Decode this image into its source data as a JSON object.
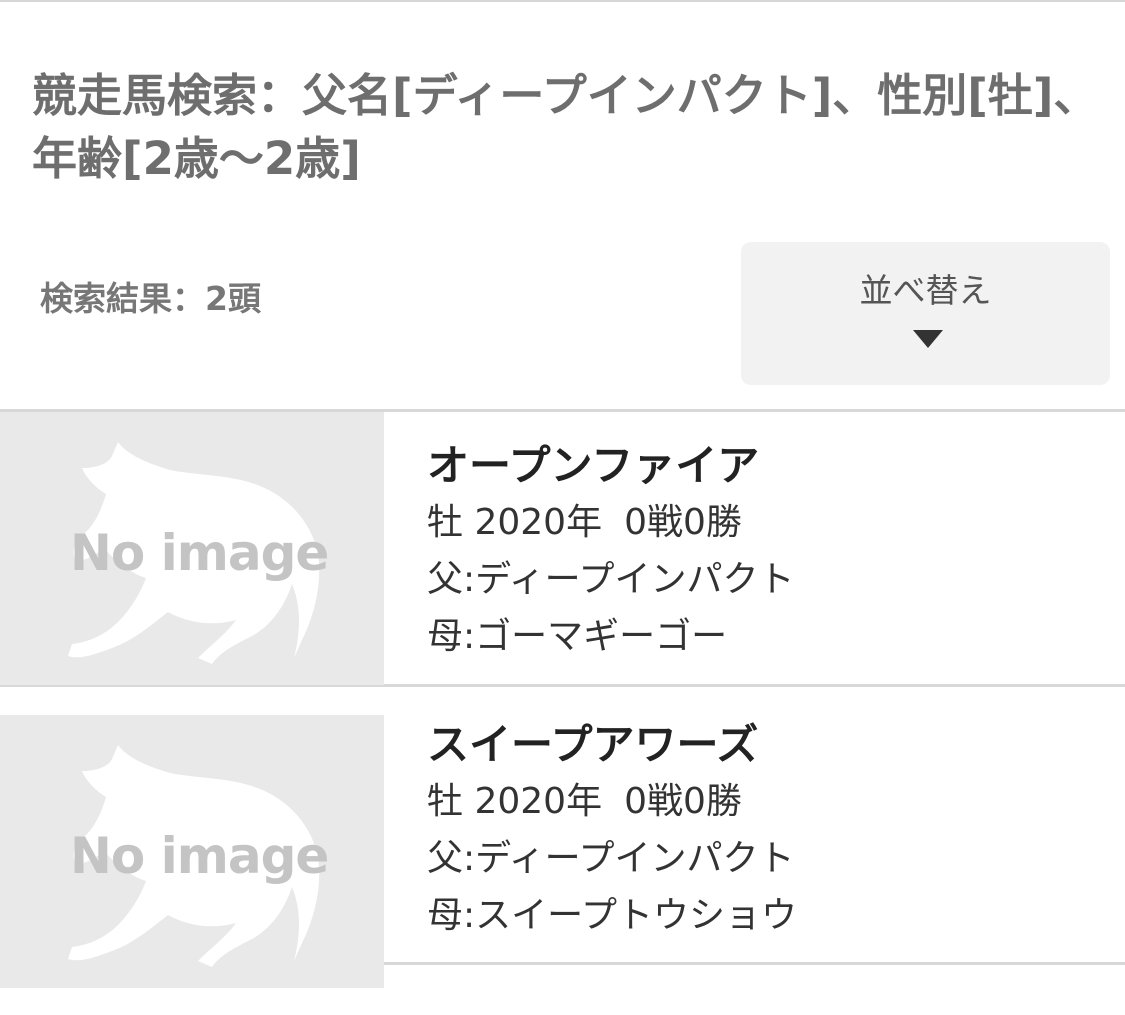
{
  "header": {
    "title": "競走馬検索：父名[ディープインパクト]、性別[牡]、年齢[2歳〜2歳]"
  },
  "results": {
    "count_text": "検索結果：2頭",
    "sort_label": "並べ替え",
    "sort_icon": "triangle-down-icon"
  },
  "horses": [
    {
      "image_placeholder": "No image",
      "name": "オープンファイア",
      "sex": "牡",
      "birth_year": "2020年",
      "record": "0戦0勝",
      "sire": "父:ディープインパクト",
      "dam": "母:ゴーマギーゴー"
    },
    {
      "image_placeholder": "No image",
      "name": "スイープアワーズ",
      "sex": "牡",
      "birth_year": "2020年",
      "record": "0戦0勝",
      "sire": "父:ディープインパクト",
      "dam": "母:スイープトウショウ"
    }
  ]
}
